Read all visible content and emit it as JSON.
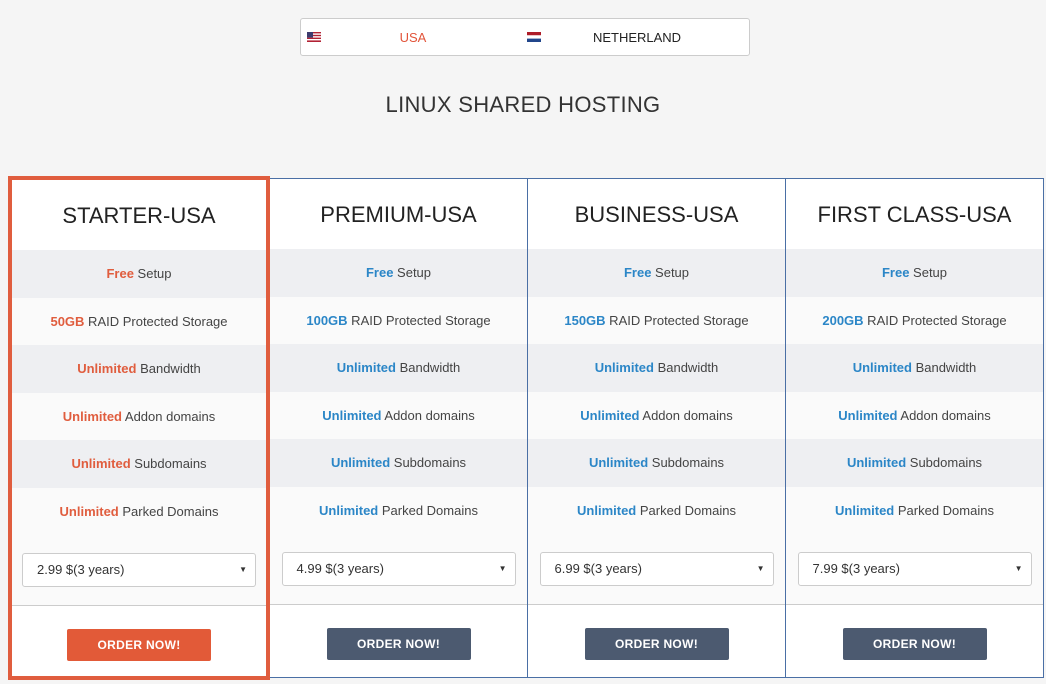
{
  "tabs": [
    {
      "label": "USA",
      "flag": "us-flag-icon"
    },
    {
      "label": "NETHERLAND",
      "flag": "netherlands-flag-icon"
    }
  ],
  "page_title": "LINUX SHARED HOSTING",
  "plans": [
    {
      "name": "STARTER-USA",
      "features": [
        {
          "hl": "Free",
          "text": " Setup"
        },
        {
          "hl": "50GB",
          "text": " RAID Protected Storage"
        },
        {
          "hl": "Unlimited",
          "text": " Bandwidth"
        },
        {
          "hl": "Unlimited",
          "text": " Addon domains"
        },
        {
          "hl": "Unlimited",
          "text": " Subdomains"
        },
        {
          "hl": "Unlimited",
          "text": " Parked Domains"
        }
      ],
      "price": "2.99 $(3 years)",
      "button": "ORDER NOW!"
    },
    {
      "name": "PREMIUM-USA",
      "features": [
        {
          "hl": "Free",
          "text": " Setup"
        },
        {
          "hl": "100GB",
          "text": " RAID Protected Storage"
        },
        {
          "hl": "Unlimited",
          "text": " Bandwidth"
        },
        {
          "hl": "Unlimited",
          "text": " Addon domains"
        },
        {
          "hl": "Unlimited",
          "text": " Subdomains"
        },
        {
          "hl": "Unlimited",
          "text": " Parked Domains"
        }
      ],
      "price": "4.99 $(3 years)",
      "button": "ORDER NOW!"
    },
    {
      "name": "BUSINESS-USA",
      "features": [
        {
          "hl": "Free",
          "text": " Setup"
        },
        {
          "hl": "150GB",
          "text": " RAID Protected Storage"
        },
        {
          "hl": "Unlimited",
          "text": " Bandwidth"
        },
        {
          "hl": "Unlimited",
          "text": " Addon domains"
        },
        {
          "hl": "Unlimited",
          "text": " Subdomains"
        },
        {
          "hl": "Unlimited",
          "text": " Parked Domains"
        }
      ],
      "price": "6.99 $(3 years)",
      "button": "ORDER NOW!"
    },
    {
      "name": "FIRST CLASS-USA",
      "features": [
        {
          "hl": "Free",
          "text": " Setup"
        },
        {
          "hl": "200GB",
          "text": " RAID Protected Storage"
        },
        {
          "hl": "Unlimited",
          "text": " Bandwidth"
        },
        {
          "hl": "Unlimited",
          "text": " Addon domains"
        },
        {
          "hl": "Unlimited",
          "text": " Subdomains"
        },
        {
          "hl": "Unlimited",
          "text": " Parked Domains"
        }
      ],
      "price": "7.99 $(3 years)",
      "button": "ORDER NOW!"
    }
  ],
  "colors": {
    "accent": "#e25a38",
    "blue": "#2b86c7",
    "button": "#4c5a70"
  }
}
